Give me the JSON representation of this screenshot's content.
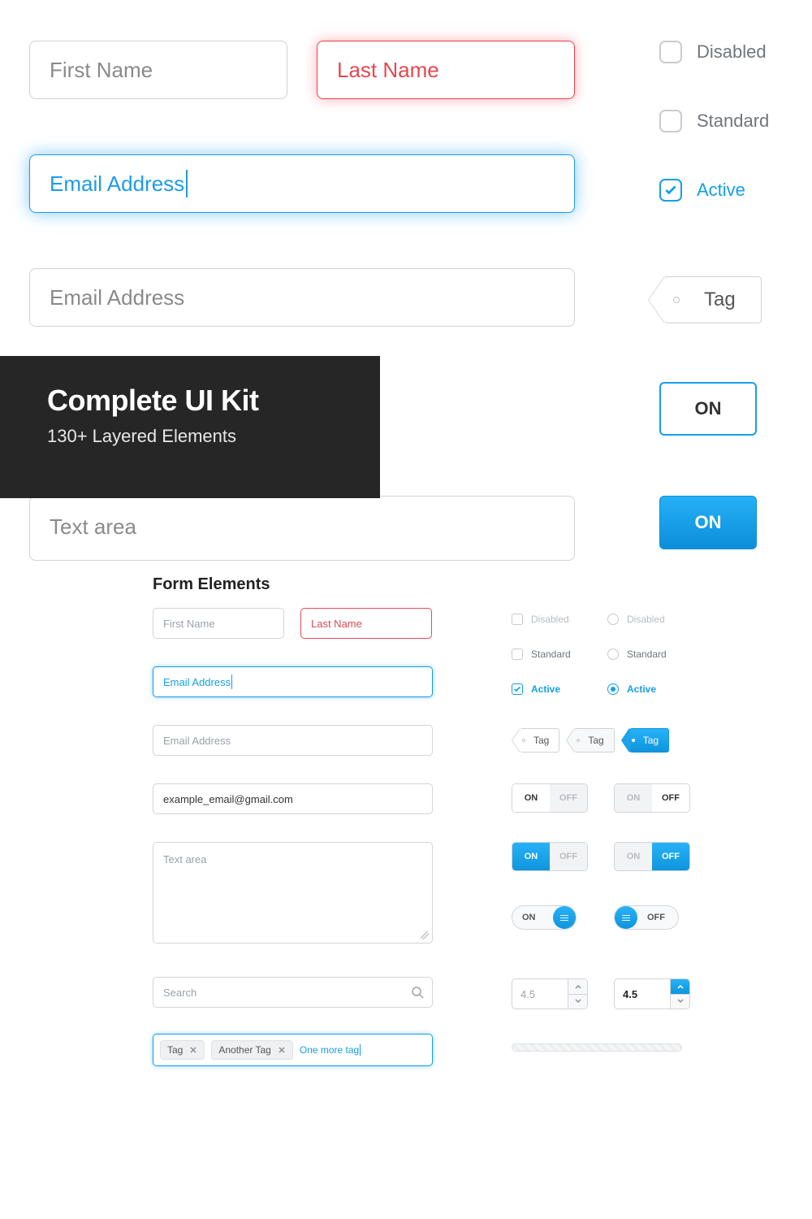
{
  "top": {
    "first_name": "First Name",
    "last_name": "Last Name",
    "email_focus": "Email Address",
    "email_plain": "Email Address",
    "textarea": "Text area",
    "overlay_title": "Complete UI Kit",
    "overlay_sub": "130+ Layered Elements",
    "cb_disabled": "Disabled",
    "cb_standard": "Standard",
    "cb_active": "Active",
    "tag": "Tag",
    "on": "ON"
  },
  "heading": "Form Elements",
  "left": {
    "first_name": "First Name",
    "last_name": "Last Name",
    "email_focus": "Email Address",
    "email_plain": "Email Address",
    "email_filled": "example_email@gmail.com",
    "textarea": "Text area",
    "search": "Search",
    "chip1": "Tag",
    "chip2": "Another Tag",
    "typing": "One more tag"
  },
  "right": {
    "cb_disabled": "Disabled",
    "cb_standard": "Standard",
    "cb_active": "Active",
    "rd_disabled": "Disabled",
    "rd_standard": "Standard",
    "rd_active": "Active",
    "tag": "Tag",
    "on": "ON",
    "off": "OFF",
    "stepper_placeholder": "4.5",
    "stepper_value": "4.5"
  }
}
